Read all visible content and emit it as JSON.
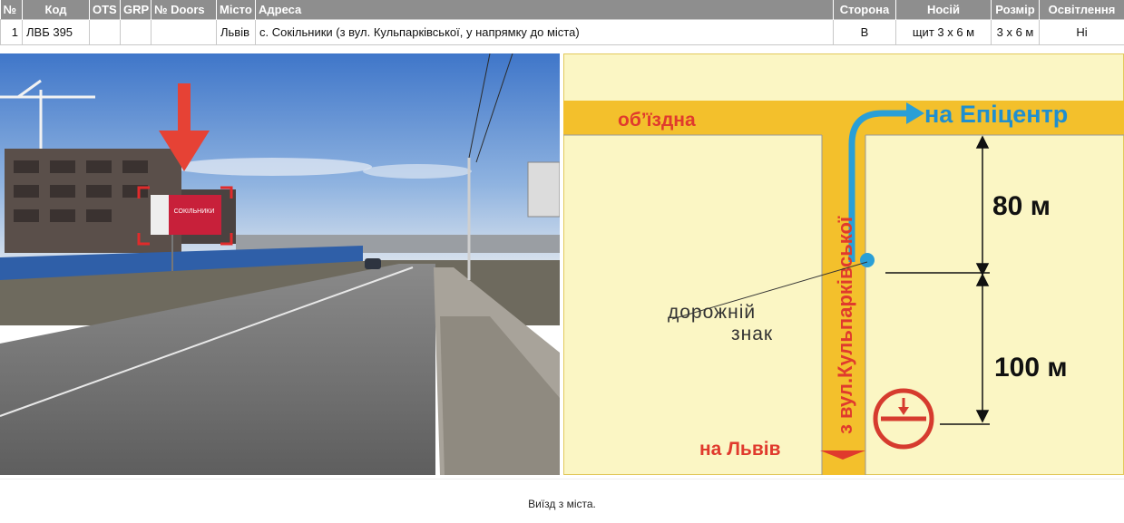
{
  "table": {
    "headers": [
      "№",
      "Код",
      "OTS",
      "GRP",
      "№ Doors",
      "Місто",
      "Адреса",
      "Сторона",
      "Носій",
      "Розмір",
      "Освітлення"
    ],
    "row": {
      "num": "1",
      "code": "ЛВБ 395",
      "ots": "",
      "grp": "",
      "doors": "",
      "city": "Львів",
      "address": "с. Сокільники (з вул. Кульпарківської, у напрямку до міста)",
      "side": "В",
      "carrier": "щит 3 x 6 м",
      "size": "3 x 6 м",
      "lighting": "Ні"
    }
  },
  "photo": {
    "billboard_text": "СОКІЛЬНИКИ"
  },
  "map": {
    "road_bypass": "об’їздна",
    "to_epicenter": "на Епіцентр",
    "street": "з вул.Кульпарківської",
    "distance_top": "80 м",
    "distance_bottom": "100 м",
    "road_sign": "дорожній знак",
    "road_sign_line1": "дорожній",
    "road_sign_line2": "знак",
    "to_lviv": "на Львів",
    "colors": {
      "background": "#fbf6c4",
      "road": "#f3c02c",
      "arrow": "#2a9fd6",
      "label_red": "#e03a2d",
      "sign": "#d63b2e"
    }
  },
  "caption": "Виїзд з міста."
}
